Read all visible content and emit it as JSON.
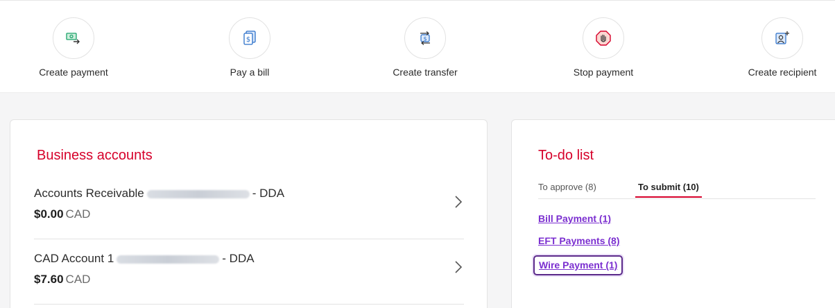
{
  "quick_actions": [
    {
      "label": "Create payment",
      "icon": "money-send-icon"
    },
    {
      "label": "Pay a bill",
      "icon": "bill-dollar-icon"
    },
    {
      "label": "Create transfer",
      "icon": "transfer-icon"
    },
    {
      "label": "Stop payment",
      "icon": "stop-hand-icon"
    },
    {
      "label": "Create recipient",
      "icon": "add-person-icon"
    }
  ],
  "business_accounts": {
    "title": "Business accounts",
    "accounts": [
      {
        "name": "Accounts Receivable",
        "suffix": "- DDA",
        "balance": "$0.00",
        "currency": "CAD"
      },
      {
        "name": "CAD Account 1",
        "suffix": "- DDA",
        "balance": "$7.60",
        "currency": "CAD"
      }
    ]
  },
  "todo": {
    "title": "To-do list",
    "tabs": [
      {
        "label": "To approve (8)",
        "active": false
      },
      {
        "label": "To submit (10)",
        "active": true
      }
    ],
    "items": [
      {
        "label": "Bill Payment (1)"
      },
      {
        "label": "EFT Payments (8)"
      },
      {
        "label": "Wire Payment (1)"
      }
    ]
  },
  "colors": {
    "brand_red": "#d6002a",
    "link_purple": "#7b2fd0",
    "icon_green": "#1aa36a",
    "icon_blue": "#2a6fc9",
    "icon_red": "#d6002a"
  }
}
